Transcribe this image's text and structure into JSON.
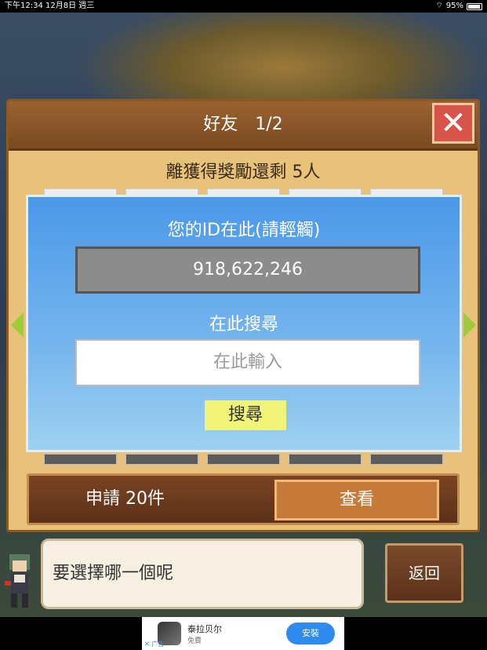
{
  "status_bar": {
    "time": "下午12:34",
    "date": "12月8日 週三",
    "battery": "95%",
    "battery_level": 0.95
  },
  "panel": {
    "title": "好友　1/2",
    "reward_remaining": "離獲得獎勵還剩 5人",
    "close_icon": "close-icon"
  },
  "dialog": {
    "id_label": "您的ID在此(請輕觸)",
    "id_value": "918,622,246",
    "search_label": "在此搜尋",
    "search_placeholder": "在此輸入",
    "search_button": "搜尋"
  },
  "requests": {
    "label": "申請 20件",
    "view_button": "查看"
  },
  "bottom": {
    "prompt": "要選擇哪一個呢",
    "back_button": "返回"
  },
  "ad": {
    "app_name": "泰拉贝尔",
    "price": "免費",
    "install": "安裝",
    "badge": "广告"
  },
  "colors": {
    "accent_blue": "#4b98e8",
    "panel_brown": "#7b4a22",
    "search_yellow": "#f2f47a",
    "close_red": "#d7544a"
  }
}
